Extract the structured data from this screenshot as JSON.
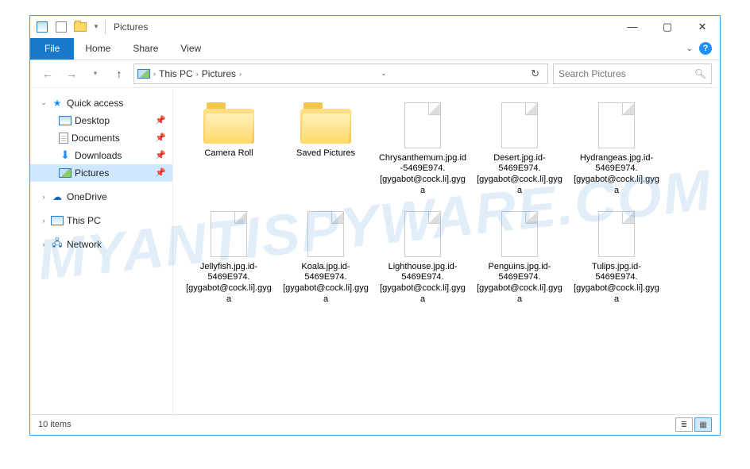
{
  "title": "Pictures",
  "ribbon": {
    "file": "File",
    "home": "Home",
    "share": "Share",
    "view": "View"
  },
  "nav": {
    "breadcrumb": [
      "This PC",
      "Pictures"
    ],
    "search_placeholder": "Search Pictures"
  },
  "sidebar": {
    "quick_access": "Quick access",
    "desktop": "Desktop",
    "documents": "Documents",
    "downloads": "Downloads",
    "pictures": "Pictures",
    "onedrive": "OneDrive",
    "this_pc": "This PC",
    "network": "Network"
  },
  "items": [
    {
      "type": "folder",
      "label": "Camera Roll"
    },
    {
      "type": "folder",
      "label": "Saved Pictures"
    },
    {
      "type": "file",
      "label": "Chrysanthemum.jpg.id-5469E974.[gygabot@cock.li].gyga"
    },
    {
      "type": "file",
      "label": "Desert.jpg.id-5469E974.[gygabot@cock.li].gyga"
    },
    {
      "type": "file",
      "label": "Hydrangeas.jpg.id-5469E974.[gygabot@cock.li].gyga"
    },
    {
      "type": "file",
      "label": "Jellyfish.jpg.id-5469E974.[gygabot@cock.li].gyga"
    },
    {
      "type": "file",
      "label": "Koala.jpg.id-5469E974.[gygabot@cock.li].gyga"
    },
    {
      "type": "file",
      "label": "Lighthouse.jpg.id-5469E974.[gygabot@cock.li].gyga"
    },
    {
      "type": "file",
      "label": "Penguins.jpg.id-5469E974.[gygabot@cock.li].gyga"
    },
    {
      "type": "file",
      "label": "Tulips.jpg.id-5469E974.[gygabot@cock.li].gyga"
    }
  ],
  "status": {
    "count": "10 items"
  },
  "watermark": "MYANTISPYWARE.COM"
}
